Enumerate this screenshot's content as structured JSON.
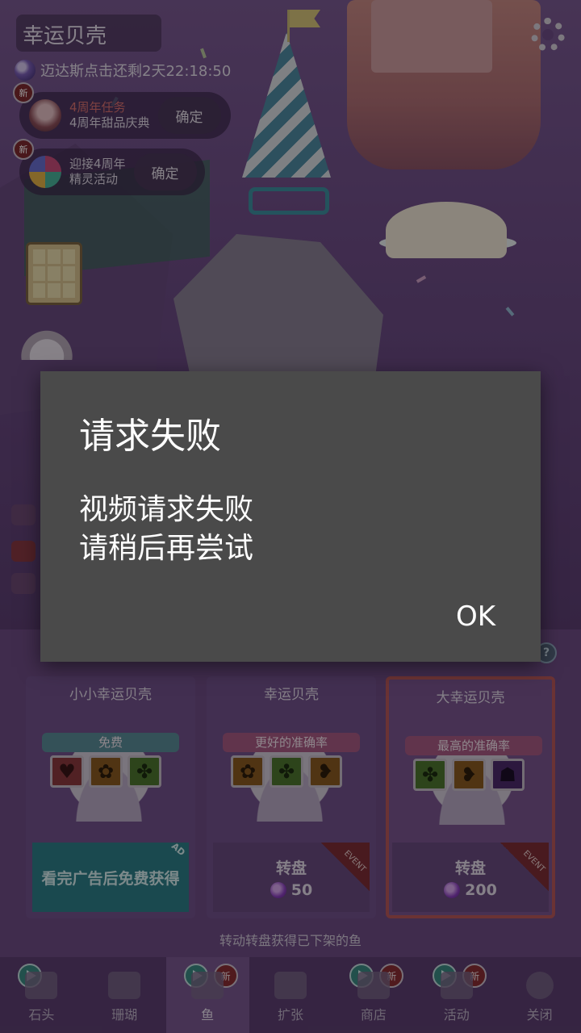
{
  "hud": {
    "title": "幸运贝壳",
    "timer_text": "迈达斯点击还剩2天22:18:50"
  },
  "quests": [
    {
      "badge": "新",
      "line1": "4周年任务",
      "line2": "4周年甜品庆典",
      "button": "确定"
    },
    {
      "badge": "新",
      "line1": "迎接4周年",
      "line2": "精灵活动",
      "button": "确定"
    }
  ],
  "help_button": "?",
  "cards": [
    {
      "title": "小小幸运贝壳",
      "ribbon": "免费",
      "slots": [
        "heart",
        "fish",
        "turtle"
      ],
      "ad_button": "看完广告后免费获得",
      "ad_tag": "AD"
    },
    {
      "title": "幸运贝壳",
      "ribbon": "更好的准确率",
      "slots": [
        "fish",
        "turtle",
        "dolphin"
      ],
      "spin_label": "转盘",
      "cost": "50",
      "event_tag": "EVENT"
    },
    {
      "title": "大幸运贝壳",
      "ribbon": "最高的准确率",
      "slots": [
        "turtle",
        "dolphin",
        "whale"
      ],
      "spin_label": "转盘",
      "cost": "200",
      "event_tag": "EVENT"
    }
  ],
  "footer_note": "转动转盘获得已下架的鱼",
  "nav": [
    {
      "label": "石头"
    },
    {
      "label": "珊瑚"
    },
    {
      "label": "鱼",
      "badge": "新"
    },
    {
      "label": "扩张"
    },
    {
      "label": "商店",
      "badge": "新"
    },
    {
      "label": "活动",
      "badge": "新"
    },
    {
      "label": "关闭"
    }
  ],
  "dialog": {
    "title": "请求失败",
    "message": "视频请求失败\n请稍后再尝试",
    "ok": "OK"
  },
  "colors": {
    "dialog_bg": "#4a4a4a",
    "ad_button": "#2d7f88",
    "selected_border": "#b9585b"
  }
}
